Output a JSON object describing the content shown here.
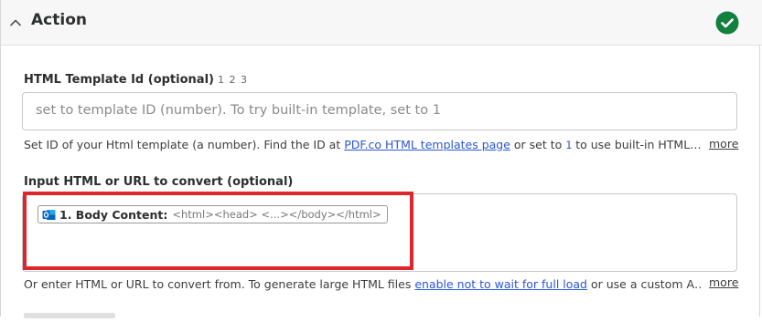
{
  "section": {
    "title": "Action",
    "status_icon": "check-circle-icon",
    "status_color": "#13803e"
  },
  "template_field": {
    "label": "HTML Template Id (optional)",
    "hint": "1 2 3",
    "placeholder": "set to template ID (number). To try built-in template, set to 1",
    "help_prefix": "Set ID of your Html template (a number). Find the ID at ",
    "help_link": "PDF.co HTML templates page",
    "help_middle": " or set to ",
    "help_code": "1",
    "help_suffix": " to use built-in HTML…",
    "more": "more"
  },
  "html_field": {
    "label": "Input HTML or URL to convert (optional)",
    "pill_icon": "outlook-icon",
    "pill_label": "1. Body Content:",
    "pill_value": "<html><head>  <...></body></html>",
    "help_prefix": "Or enter HTML or URL to convert from. To generate large HTML files ",
    "help_link": "enable not to wait for full load",
    "help_suffix": " or use a custom A…",
    "more": "more"
  },
  "colors": {
    "highlight": "#e0262d",
    "link": "#2b56d8",
    "outlook_blue": "#0a64c9"
  }
}
